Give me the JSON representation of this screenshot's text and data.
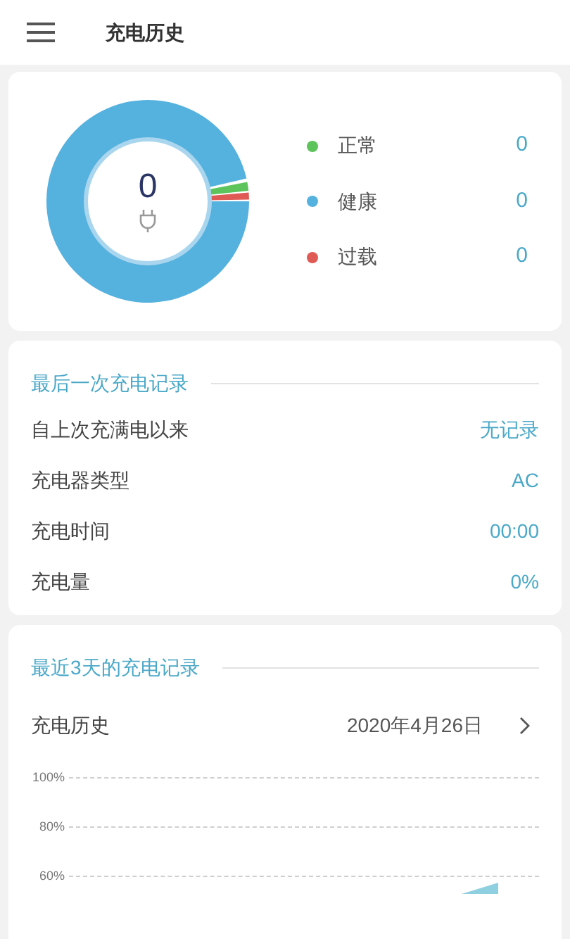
{
  "header": {
    "title": "充电历史"
  },
  "summary": {
    "center_value": "0",
    "legend": [
      {
        "label": "正常",
        "value": "0",
        "color": "#5cc45a"
      },
      {
        "label": "健康",
        "value": "0",
        "color": "#55b1de"
      },
      {
        "label": "过载",
        "value": "0",
        "color": "#e05a55"
      }
    ]
  },
  "last_record": {
    "title": "最后一次充电记录",
    "rows": [
      {
        "label": "自上次充满电以来",
        "value": "无记录"
      },
      {
        "label": "充电器类型",
        "value": "AC"
      },
      {
        "label": "充电时间",
        "value": "00:00"
      },
      {
        "label": "充电量",
        "value": "0%"
      }
    ]
  },
  "recent": {
    "title": "最近3天的充电记录",
    "row": {
      "label": "充电历史",
      "date": "2020年4月26日"
    },
    "y_labels": [
      "100%",
      "80%",
      "60%"
    ]
  }
}
